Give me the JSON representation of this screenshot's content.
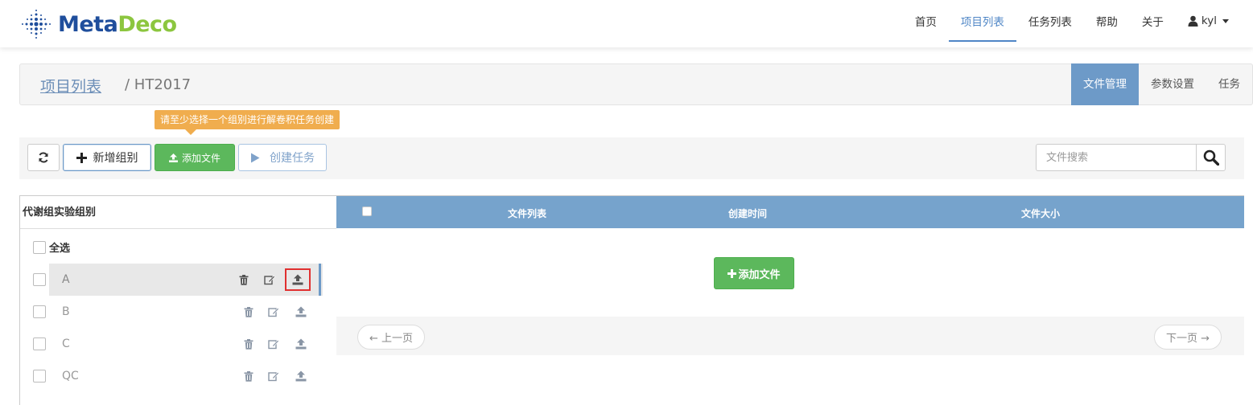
{
  "brand": {
    "part1": "Meta",
    "part2": "Deco"
  },
  "nav": {
    "items": [
      {
        "label": "首页",
        "active": false
      },
      {
        "label": "项目列表",
        "active": true
      },
      {
        "label": "任务列表",
        "active": false
      },
      {
        "label": "帮助",
        "active": false
      },
      {
        "label": "关于",
        "active": false
      }
    ],
    "user": "kyl"
  },
  "breadcrumb": {
    "root": "项目列表",
    "current": "/ HT2017"
  },
  "tabs": [
    {
      "label": "文件管理",
      "active": true
    },
    {
      "label": "参数设置",
      "active": false
    },
    {
      "label": "任务",
      "active": false
    }
  ],
  "tooltip": "请至少选择一个组别进行解卷积任务创建",
  "toolbar": {
    "new_group": "新增组别",
    "add_file": "添加文件",
    "create_task": "创建任务",
    "search_placeholder": "文件搜索"
  },
  "groups_panel": {
    "title": "代谢组实验组别",
    "select_all": "全选",
    "groups": [
      "A",
      "B",
      "C",
      "QC"
    ],
    "selected_group": "A"
  },
  "file_table": {
    "columns": [
      "文件列表",
      "创建时间",
      "文件大小"
    ],
    "rows": [],
    "add_file_button": "添加文件"
  },
  "pager": {
    "prev": "← 上一页",
    "next": "下一页 →"
  },
  "colors": {
    "accent": "#6d9ac8",
    "success": "#5cb85c",
    "warning": "#f0ad4e",
    "highlight": "#e03030"
  }
}
